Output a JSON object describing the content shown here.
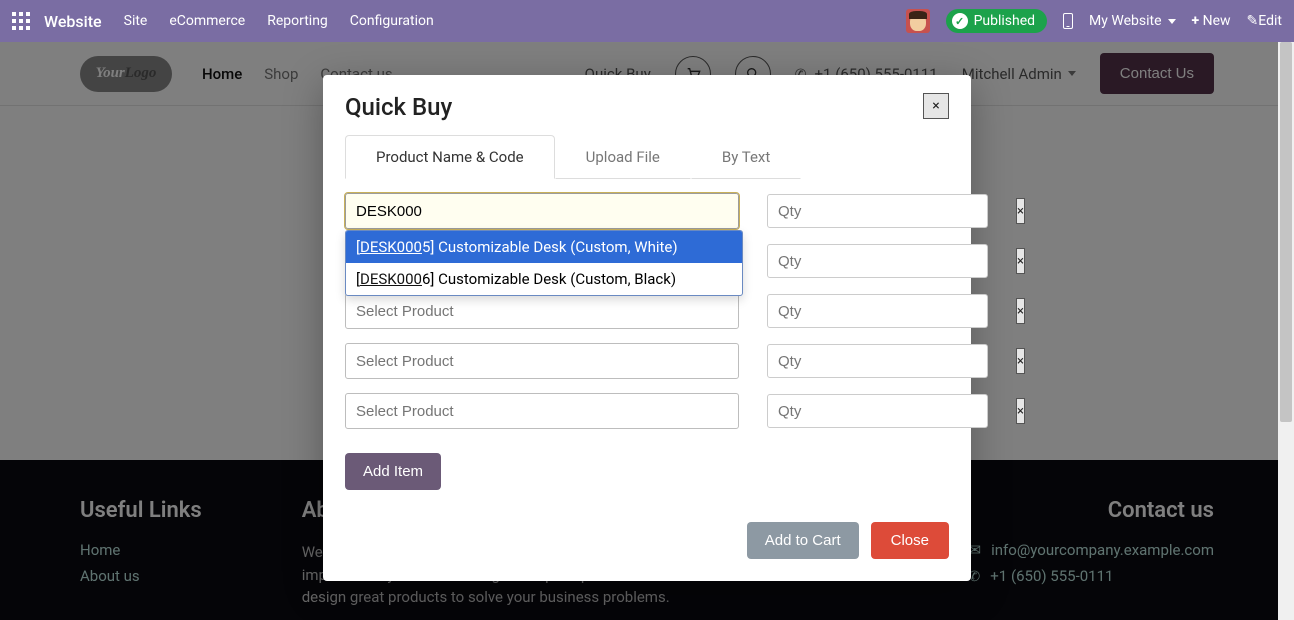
{
  "topbar": {
    "brand": "Website",
    "nav": [
      "Site",
      "eCommerce",
      "Reporting",
      "Configuration"
    ],
    "published": "Published",
    "site_selector": "My Website",
    "new": "New",
    "edit": "Edit"
  },
  "header": {
    "logo_a": "Your",
    "logo_b": "Logo",
    "nav": [
      {
        "label": "Home",
        "active": true
      },
      {
        "label": "Shop",
        "active": false
      },
      {
        "label": "Contact us",
        "active": false
      }
    ],
    "quick_buy": "Quick Buy",
    "phone": "+1 (650) 555-0111",
    "user": "Mitchell Admin",
    "contact_btn": "Contact Us"
  },
  "footer": {
    "col1_title": "Useful Links",
    "links": [
      "Home",
      "About us"
    ],
    "col2_title": "About us",
    "about_text": "We are a team of passionate people whose goal is to improve everyone's life through disruptive products. We design great products to solve your business problems.",
    "col3_title": "Contact us",
    "email": "info@yourcompany.example.com",
    "phone": "+1 (650) 555-0111"
  },
  "modal": {
    "title": "Quick Buy",
    "tabs": [
      "Product Name & Code",
      "Upload File",
      "By Text"
    ],
    "active_tab": 0,
    "rows": [
      {
        "value": "DESK000",
        "placeholder": "Select Product",
        "qty_placeholder": "Qty"
      },
      {
        "value": "",
        "placeholder": "Select Product",
        "qty_placeholder": "Qty"
      },
      {
        "value": "",
        "placeholder": "Select Product",
        "qty_placeholder": "Qty"
      },
      {
        "value": "",
        "placeholder": "Select Product",
        "qty_placeholder": "Qty"
      },
      {
        "value": "",
        "placeholder": "Select Product",
        "qty_placeholder": "Qty"
      }
    ],
    "suggestions": [
      {
        "code": "DESK0005",
        "match_prefix": "DESK000",
        "rest": "5",
        "name": "Customizable Desk (Custom, White)",
        "selected": true
      },
      {
        "code": "DESK0006",
        "match_prefix": "DESK000",
        "rest": "6",
        "name": "Customizable Desk (Custom, Black)",
        "selected": false
      }
    ],
    "add_item": "Add Item",
    "add_to_cart": "Add to Cart",
    "close": "Close",
    "x": "×"
  }
}
